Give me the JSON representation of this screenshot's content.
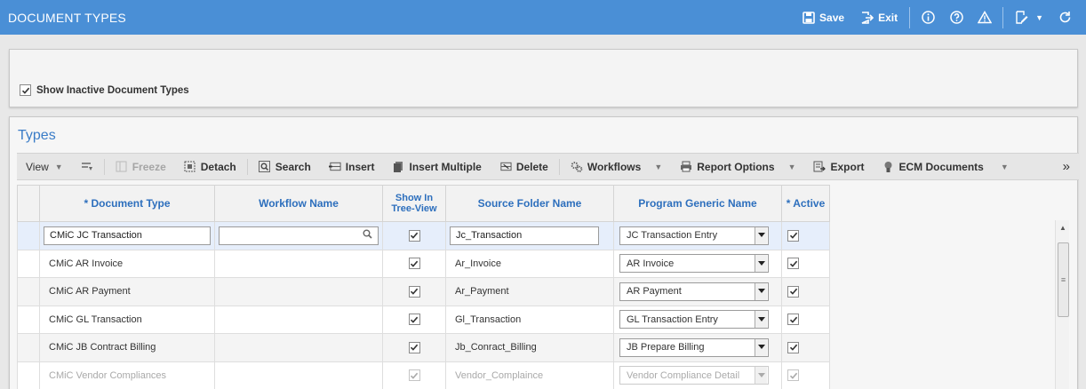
{
  "header": {
    "title": "DOCUMENT TYPES",
    "save_label": "Save",
    "exit_label": "Exit"
  },
  "filter": {
    "show_inactive_label": "Show Inactive Document Types",
    "show_inactive_checked": true
  },
  "types": {
    "title": "Types",
    "toolbar": {
      "view": "View",
      "freeze": "Freeze",
      "detach": "Detach",
      "search": "Search",
      "insert": "Insert",
      "insert_multiple": "Insert Multiple",
      "delete": "Delete",
      "workflows": "Workflows",
      "report_options": "Report Options",
      "export": "Export",
      "ecm_documents": "ECM Documents",
      "more": "»"
    },
    "columns": {
      "document_type": "* Document Type",
      "workflow_name": "Workflow Name",
      "show_in_tree_view": "Show In Tree-View",
      "source_folder_name": "Source Folder Name",
      "program_generic_name": "Program Generic Name",
      "active": "* Active"
    },
    "rows": [
      {
        "document_type": "CMiC  JC Transaction",
        "workflow_name": "",
        "show_in_tree_view": true,
        "source_folder_name": "Jc_Transaction",
        "program_generic_name": "JC Transaction Entry",
        "active": true
      },
      {
        "document_type": "CMiC AR Invoice",
        "workflow_name": "",
        "show_in_tree_view": true,
        "source_folder_name": "Ar_Invoice",
        "program_generic_name": "AR Invoice",
        "active": true
      },
      {
        "document_type": "CMiC AR Payment",
        "workflow_name": "",
        "show_in_tree_view": true,
        "source_folder_name": "Ar_Payment",
        "program_generic_name": "AR Payment",
        "active": true
      },
      {
        "document_type": "CMiC GL Transaction",
        "workflow_name": "",
        "show_in_tree_view": true,
        "source_folder_name": "Gl_Transaction",
        "program_generic_name": "GL Transaction Entry",
        "active": true
      },
      {
        "document_type": "CMiC JB Contract Billing",
        "workflow_name": "",
        "show_in_tree_view": true,
        "source_folder_name": "Jb_Conract_Billing",
        "program_generic_name": "JB Prepare Billing",
        "active": true
      },
      {
        "document_type": "CMiC Vendor Compliances",
        "workflow_name": "",
        "show_in_tree_view": true,
        "source_folder_name": "Vendor_Complaince",
        "program_generic_name": "Vendor Compliance Detail",
        "active": true
      }
    ]
  },
  "colors": {
    "header_bg": "#4a8fd6",
    "column_header_text": "#2d6fbd",
    "section_title": "#3a7cc7",
    "selected_row": "#e6eefb"
  }
}
